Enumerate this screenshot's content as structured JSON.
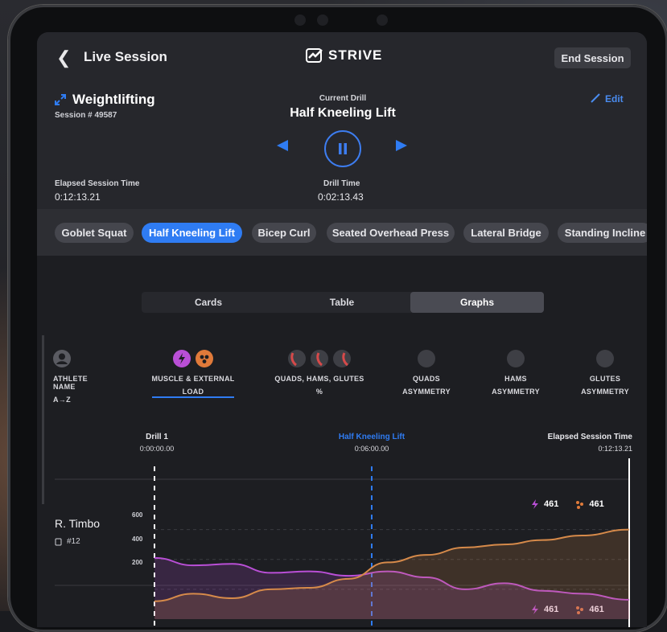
{
  "header": {
    "title": "Live Session",
    "brand": "STRIVE",
    "end_label": "End Session"
  },
  "session": {
    "sport": "Weightlifting",
    "session_number": "Session # 49587",
    "current_drill_label": "Current Drill",
    "current_drill": "Half Kneeling Lift",
    "edit_label": "Edit",
    "elapsed_label": "Elapsed Session Time",
    "elapsed_value": "0:12:13.21",
    "drill_time_label": "Drill Time",
    "drill_time_value": "0:02:13.43"
  },
  "drills": [
    "Goblet Squat",
    "Half Kneeling Lift",
    "Bicep Curl",
    "Seated Overhead Press",
    "Lateral Bridge",
    "Standing Incline"
  ],
  "active_drill_index": 1,
  "view_tabs": [
    "Cards",
    "Table",
    "Graphs"
  ],
  "active_view": "Graphs",
  "sort_columns": [
    {
      "line1": "ATHLETE NAME",
      "line2": "A→Z"
    },
    {
      "line1": "MUSCLE & EXTERNAL",
      "line2": "LOAD"
    },
    {
      "line1": "QUADS, HAMS, GLUTES",
      "line2": "%"
    },
    {
      "line1": "QUADS",
      "line2": "ASYMMETRY"
    },
    {
      "line1": "HAMS",
      "line2": "ASYMMETRY"
    },
    {
      "line1": "GLUTES",
      "line2": "ASYMMETRY"
    }
  ],
  "timeline": {
    "start_label": "Drill 1",
    "start_time": "0:00:00.00",
    "mid_label": "Half Kneeling Lift",
    "mid_time": "0:06:00.00",
    "end_label": "Elapsed Session Time",
    "end_time": "0:12:13.21"
  },
  "athlete": {
    "name": "R. Timbo",
    "number": "#12",
    "muscle_value": "461",
    "external_value": "461"
  },
  "next_row": {
    "muscle_value": "461",
    "external_value": "461"
  },
  "chart_data": {
    "type": "area",
    "xlim": [
      0,
      733.21
    ],
    "ylim": [
      0,
      700
    ],
    "yticks": [
      "600",
      "400",
      "200"
    ],
    "series": [
      {
        "color": "#b94fd6",
        "x": [
          0,
          60,
          120,
          180,
          240,
          300,
          360,
          420,
          480,
          540,
          600,
          660,
          733
        ],
        "values": [
          410,
          360,
          370,
          310,
          320,
          290,
          320,
          280,
          200,
          240,
          190,
          170,
          130
        ]
      },
      {
        "color": "#d68a4a",
        "x": [
          0,
          60,
          120,
          180,
          240,
          300,
          360,
          420,
          480,
          540,
          600,
          660,
          733
        ],
        "values": [
          120,
          170,
          140,
          200,
          210,
          270,
          380,
          430,
          480,
          500,
          530,
          560,
          600
        ]
      }
    ]
  },
  "colors": {
    "accent": "#2f7cf3",
    "muscle": "#b94fd6",
    "external": "#e07a3a"
  }
}
